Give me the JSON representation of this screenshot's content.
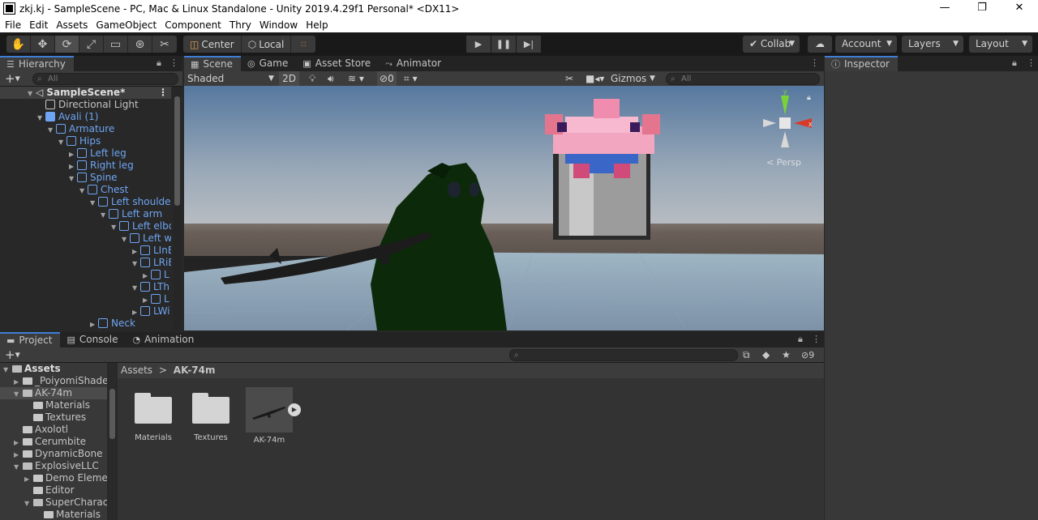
{
  "window": {
    "title": "zkj.kj - SampleScene - PC, Mac & Linux Standalone - Unity 2019.4.29f1 Personal* <DX11>"
  },
  "menu": [
    "File",
    "Edit",
    "Assets",
    "GameObject",
    "Component",
    "Thry",
    "Window",
    "Help"
  ],
  "toolbar": {
    "center_label": "Center",
    "local_label": "Local",
    "collab_label": "Collab",
    "account_label": "Account",
    "layers_label": "Layers",
    "layout_label": "Layout"
  },
  "hierarchy": {
    "tab": "Hierarchy",
    "search_placeholder": "All",
    "scene": "SampleScene*",
    "items": [
      {
        "label": "Directional Light"
      },
      {
        "label": "Avali (1)"
      },
      {
        "label": "Armature"
      },
      {
        "label": "Hips"
      },
      {
        "label": "Left leg"
      },
      {
        "label": "Right leg"
      },
      {
        "label": "Spine"
      },
      {
        "label": "Chest"
      },
      {
        "label": "Left shoulder"
      },
      {
        "label": "Left arm"
      },
      {
        "label": "Left elbo"
      },
      {
        "label": "Left w"
      },
      {
        "label": "LInE"
      },
      {
        "label": "LRiE"
      },
      {
        "label": "L"
      },
      {
        "label": "LTh"
      },
      {
        "label": "L"
      },
      {
        "label": "LWi"
      },
      {
        "label": "Neck"
      }
    ]
  },
  "scene": {
    "tabs": [
      "Scene",
      "Game",
      "Asset Store",
      "Animator"
    ],
    "shading": "Shaded",
    "mode_2d": "2D",
    "hidden_count": "0",
    "gizmos": "Gizmos",
    "search_placeholder": "All",
    "persp": "< Persp"
  },
  "inspector": {
    "tab": "Inspector"
  },
  "project": {
    "tabs": [
      "Project",
      "Console",
      "Animation"
    ],
    "hidden_count": "9",
    "breadcrumb_root": "Assets",
    "breadcrumb_sep": ">",
    "breadcrumb_current": "AK-74m",
    "tree": [
      {
        "label": "Assets"
      },
      {
        "label": "_PoiyomiShaders"
      },
      {
        "label": "AK-74m"
      },
      {
        "label": "Materials"
      },
      {
        "label": "Textures"
      },
      {
        "label": "Axolotl"
      },
      {
        "label": "Cerumbite"
      },
      {
        "label": "DynamicBone"
      },
      {
        "label": "ExplosiveLLC"
      },
      {
        "label": "Demo Elemen"
      },
      {
        "label": "Editor"
      },
      {
        "label": "SuperCharact"
      },
      {
        "label": "Materials"
      }
    ],
    "assets": [
      {
        "label": "Materials"
      },
      {
        "label": "Textures"
      },
      {
        "label": "AK-74m"
      }
    ]
  },
  "colors": {
    "accent": "#3f7ed5",
    "prefab_blue": "#6ea5f2",
    "sky_top": "#5a7fb4",
    "ground": "#6f6660"
  }
}
